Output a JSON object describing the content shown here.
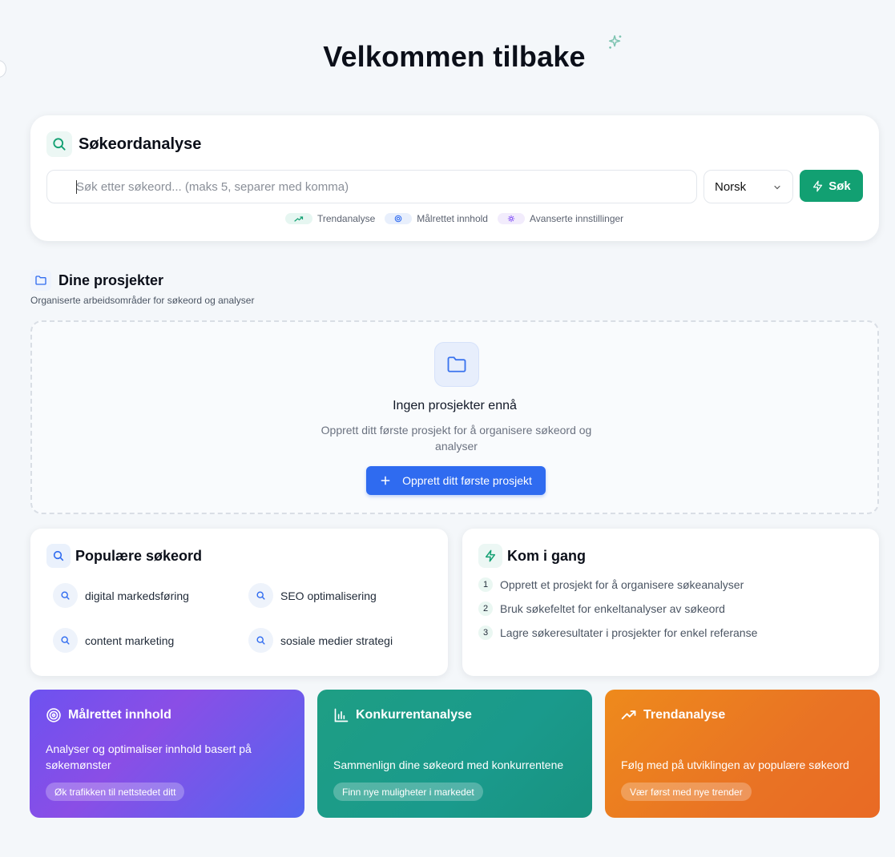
{
  "header": {
    "title": "Velkommen tilbake"
  },
  "keyword_analysis": {
    "title": "Søkeordanalyse",
    "search_placeholder": "Søk etter søkeord... (maks 5, separer med komma)",
    "language": "Norsk",
    "search_button": "Søk",
    "features": [
      "Trendanalyse",
      "Målrettet innhold",
      "Avanserte innstillinger"
    ]
  },
  "projects": {
    "title": "Dine prosjekter",
    "subtitle": "Organiserte arbeidsområder for søkeord og analyser",
    "empty_title": "Ingen prosjekter ennå",
    "empty_desc": "Opprett ditt første prosjekt for å organisere søkeord og analyser",
    "create_button": "Opprett ditt første prosjekt"
  },
  "popular_keywords": {
    "title": "Populære søkeord",
    "items": [
      "digital markedsføring",
      "SEO optimalisering",
      "content marketing",
      "sosiale medier strategi"
    ]
  },
  "get_started": {
    "title": "Kom i gang",
    "steps": [
      "Opprett et prosjekt for å organisere søkeanalyser",
      "Bruk søkefeltet for enkeltanalyser av søkeord",
      "Lagre søkeresultater i prosjekter for enkel referanse"
    ]
  },
  "feature_cards": [
    {
      "title": "Målrettet innhold",
      "desc": "Analyser og optimaliser innhold basert på søkemønster",
      "tag": "Øk trafikken til nettstedet ditt"
    },
    {
      "title": "Konkurrentanalyse",
      "desc": "Sammenlign dine søkeord med konkurrentene",
      "tag": "Finn nye muligheter i markedet"
    },
    {
      "title": "Trendanalyse",
      "desc": "Følg med på utviklingen av populære søkeord",
      "tag": "Vær først med nye trender"
    }
  ],
  "colors": {
    "accent_green": "#12a072",
    "accent_blue": "#2f6bf0"
  }
}
